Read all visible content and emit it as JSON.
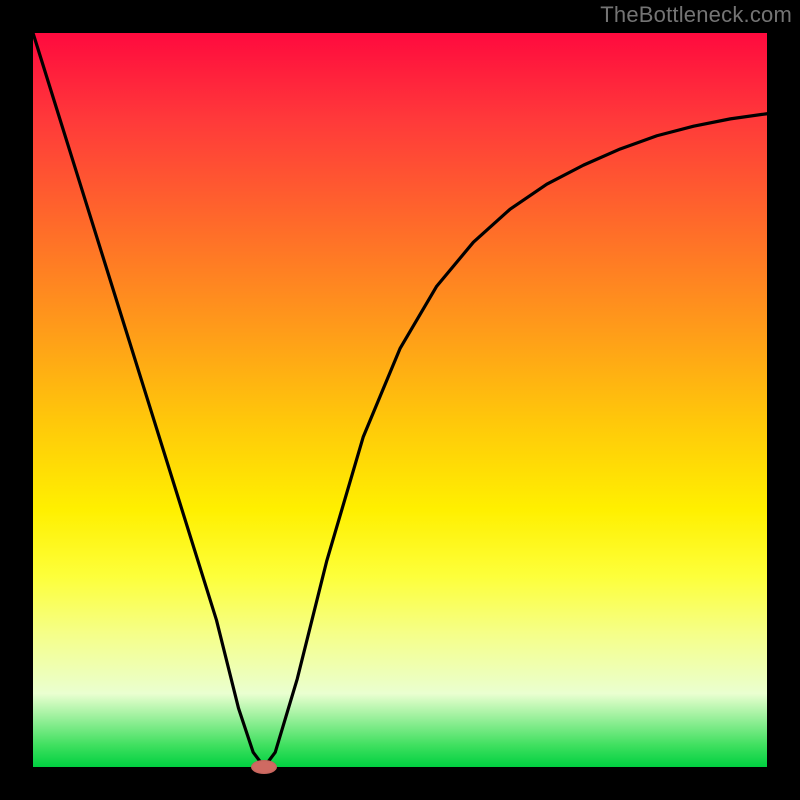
{
  "watermark": "TheBottleneck.com",
  "colors": {
    "background": "#000000",
    "gradient_top": "#ff0a3e",
    "gradient_bottom": "#00d040",
    "curve": "#000000",
    "marker": "#cf6a62",
    "watermark": "#747474"
  },
  "chart_data": {
    "type": "line",
    "title": "",
    "xlabel": "",
    "ylabel": "",
    "xlim": [
      0,
      100
    ],
    "ylim": [
      0,
      100
    ],
    "grid": false,
    "legend": false,
    "series": [
      {
        "name": "bottleneck-curve",
        "x": [
          0,
          5,
          10,
          15,
          20,
          25,
          28,
          30,
          31.5,
          33,
          36,
          40,
          45,
          50,
          55,
          60,
          65,
          70,
          75,
          80,
          85,
          90,
          95,
          100
        ],
        "values": [
          100,
          84,
          68,
          52,
          36,
          20,
          8,
          2,
          0,
          2,
          12,
          28,
          45,
          57,
          65.5,
          71.5,
          76,
          79.4,
          82,
          84.2,
          86,
          87.3,
          88.3,
          89
        ]
      }
    ],
    "annotations": [
      {
        "type": "marker",
        "shape": "ellipse",
        "x": 31.5,
        "y": 0
      }
    ],
    "notes": "Chart has no visible axis ticks, labels, or legend. Values estimated from curve shape; minimum (0) occurs near x≈31.5. Right branch asymptotically approaches ≈89."
  }
}
